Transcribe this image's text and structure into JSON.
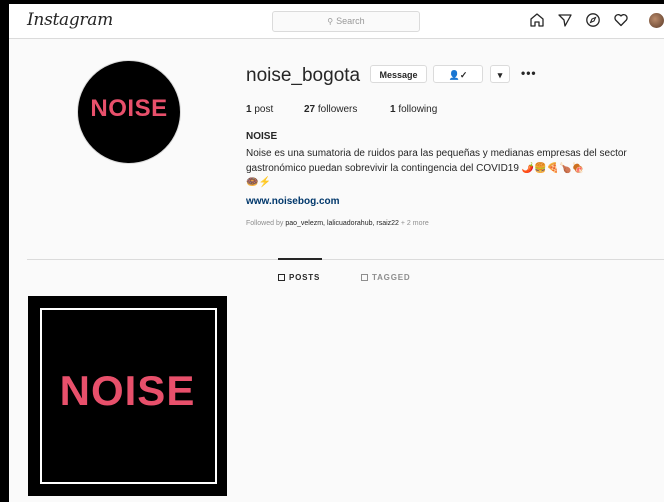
{
  "nav": {
    "logo": "Instagram",
    "search_placeholder": "Search",
    "icons": [
      "home-icon",
      "direct-icon",
      "explore-icon",
      "activity-icon",
      "profile-avatar"
    ]
  },
  "profile": {
    "avatar_text": "NOISE",
    "username": "noise_bogota",
    "message_button": "Message",
    "follow_button": "👤✓",
    "more_button": "▾",
    "options": "•••",
    "stats": {
      "posts_count": "1",
      "posts_label": "post",
      "followers_count": "27",
      "followers_label": "followers",
      "following_count": "1",
      "following_label": "following"
    },
    "full_name": "NOISE",
    "bio": "Noise es una sumatoria de ruidos para las pequeñas y medianas empresas del sector gastronómico puedan sobrevivir la contingencia del COVID19 🌶️🍔🍕🍗🍖",
    "bio_line2": "🍩⚡",
    "website": "www.noisebog.com",
    "followed_by_prefix": "Followed by",
    "followed_by_names": "pao_velezm, lalicuadorahub, rsaiz22",
    "followed_by_more": "+ 2 more"
  },
  "tabs": {
    "posts": "POSTS",
    "tagged": "TAGGED"
  },
  "post": {
    "text": "NOISE"
  },
  "colors": {
    "brand_pink": "#e8506b",
    "link": "#00376b",
    "border": "#dbdbdb"
  }
}
